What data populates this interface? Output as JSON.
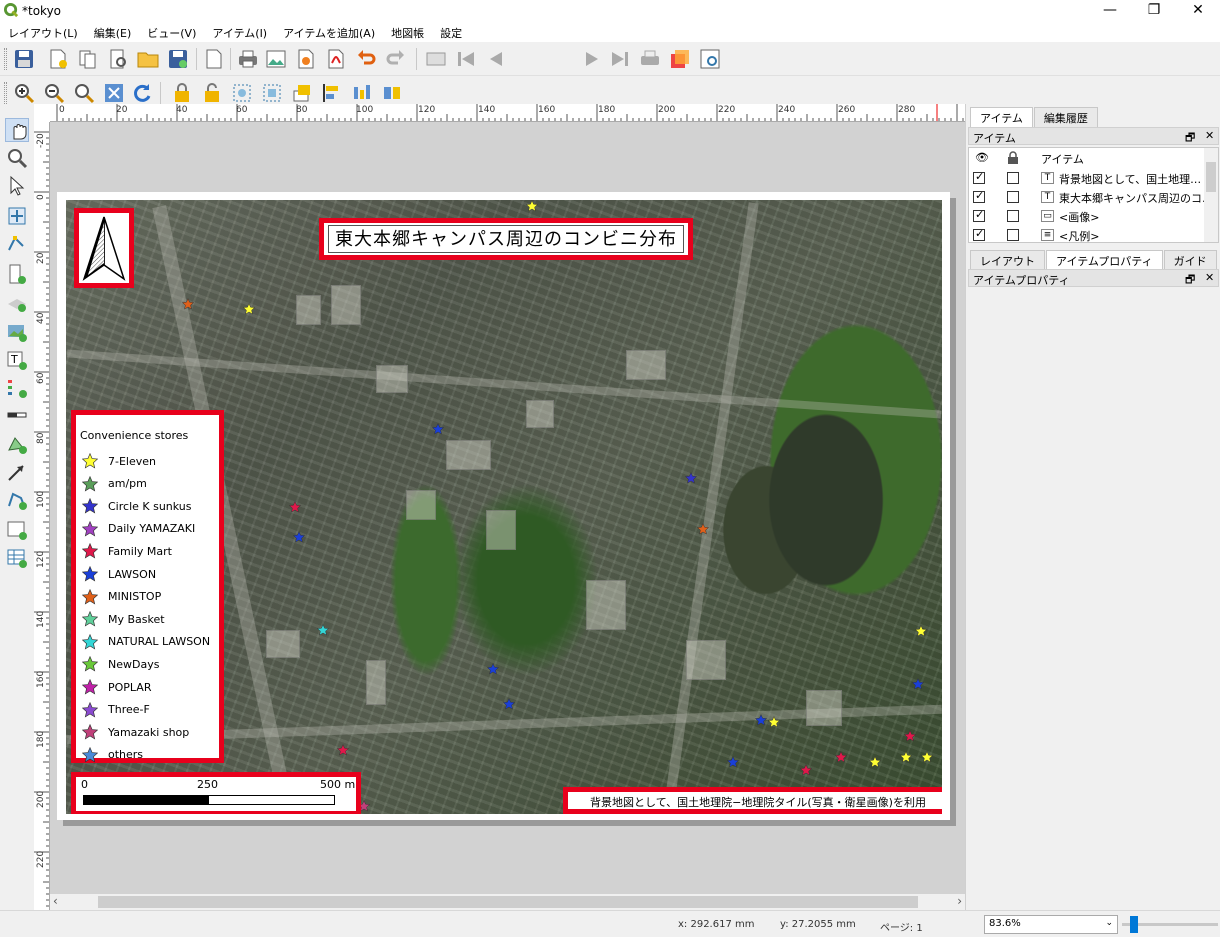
{
  "window": {
    "title": "*tokyo",
    "controls": [
      "—",
      "❐",
      "✕"
    ]
  },
  "menu": [
    "レイアウト(L)",
    "編集(E)",
    "ビュー(V)",
    "アイテム(I)",
    "アイテムを追加(A)",
    "地図帳",
    "設定"
  ],
  "toolbar": {
    "page_value": "1"
  },
  "ruler": {
    "h_labels": [
      "0",
      "20",
      "40",
      "60",
      "80",
      "100",
      "120",
      "140",
      "160",
      "180",
      "200",
      "220",
      "240",
      "260",
      "280"
    ],
    "v_labels": [
      "-20",
      "0",
      "20",
      "40",
      "60",
      "80",
      "100",
      "120",
      "140",
      "160",
      "180",
      "200",
      "220"
    ]
  },
  "layout": {
    "map_title": "東大本郷キャンパス周辺のコンビニ分布",
    "legend": {
      "title": "Convenience stores",
      "items": [
        {
          "label": "7-Eleven",
          "color": "#ffff33"
        },
        {
          "label": "am/pm",
          "color": "#5a9e5a"
        },
        {
          "label": "Circle K sunkus",
          "color": "#3333cc"
        },
        {
          "label": "Daily YAMAZAKI",
          "color": "#a040c0"
        },
        {
          "label": "Family Mart",
          "color": "#e0184a"
        },
        {
          "label": "LAWSON",
          "color": "#1a3fd8"
        },
        {
          "label": "MINISTOP",
          "color": "#e0601a"
        },
        {
          "label": "My Basket",
          "color": "#5fcf9a"
        },
        {
          "label": "NATURAL LAWSON",
          "color": "#33d6d6"
        },
        {
          "label": "NewDays",
          "color": "#6ac83a"
        },
        {
          "label": "POPLAR",
          "color": "#c020a8"
        },
        {
          "label": "Three-F",
          "color": "#8a4ad0"
        },
        {
          "label": "Yamazaki shop",
          "color": "#c0407a"
        },
        {
          "label": "others",
          "color": "#4a8ad8"
        }
      ]
    },
    "scale": {
      "l0": "0",
      "l1": "250",
      "l2": "500 m"
    },
    "credit": "背景地図として、国土地理院−地理院タイル(写真・衛星画像)を利用"
  },
  "dock": {
    "tabs_top": [
      "アイテム",
      "編集履歴"
    ],
    "items_panel_title": "アイテム",
    "items_col": "アイテム",
    "items": [
      {
        "label": "背景地図として、国土地理…",
        "icon": "T"
      },
      {
        "label": "東大本郷キャンパス周辺のコ…",
        "icon": "T"
      },
      {
        "label": "<画像>",
        "icon": "▭"
      },
      {
        "label": "<凡例>",
        "icon": "≡"
      }
    ],
    "tabs_bottom": [
      "レイアウト",
      "アイテムプロパティ",
      "ガイド"
    ],
    "props_panel_title": "アイテムプロパティ"
  },
  "status": {
    "x": "x: 292.617 mm",
    "y": "y: 27.2055 mm",
    "page": "ページ: 1",
    "zoom": "83.6%"
  }
}
